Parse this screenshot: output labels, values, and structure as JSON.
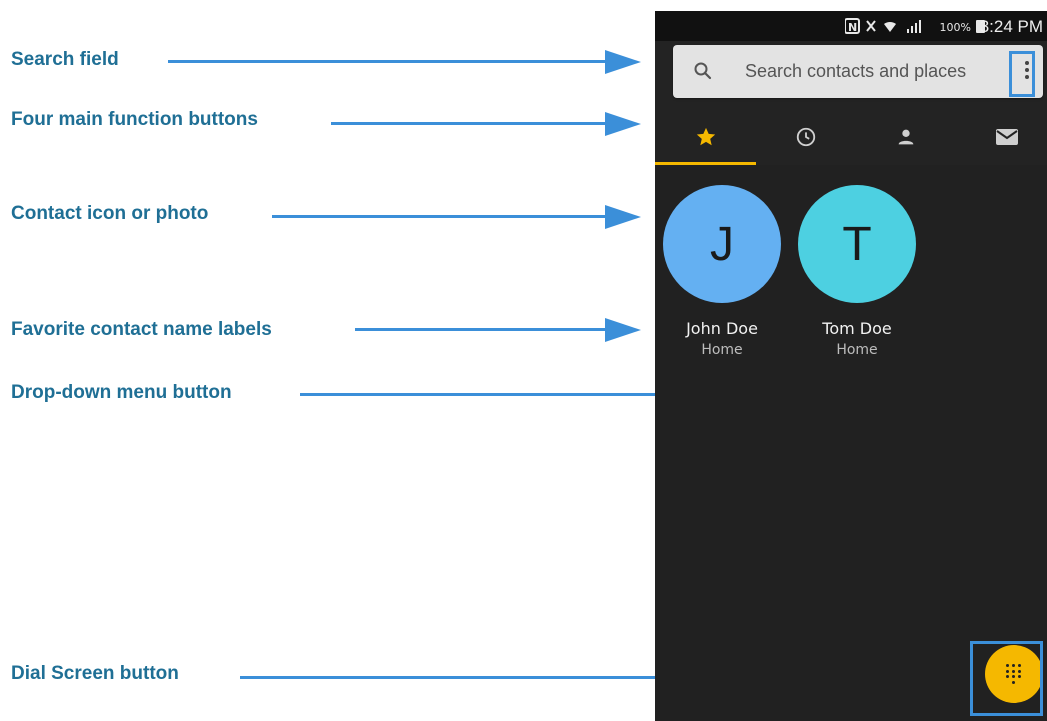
{
  "callouts": {
    "search_field": "Search field",
    "function_buttons": "Four main function buttons",
    "contact_icon": "Contact icon or photo",
    "name_labels": "Favorite contact name labels",
    "dropdown_menu": "Drop-down menu button",
    "dial_screen": "Dial Screen button"
  },
  "status_bar": {
    "battery_percent": "100%",
    "time": "3:24 PM"
  },
  "search": {
    "placeholder": "Search contacts and places"
  },
  "tabs": [
    {
      "icon": "star-icon",
      "selected": true
    },
    {
      "icon": "clock-icon",
      "selected": false
    },
    {
      "icon": "person-icon",
      "selected": false
    },
    {
      "icon": "mail-icon",
      "selected": false
    }
  ],
  "favorites": [
    {
      "initial": "J",
      "name": "John Doe",
      "label": "Home",
      "color": "#64b0f2"
    },
    {
      "initial": "T",
      "name": "Tom Doe",
      "label": "Home",
      "color": "#4dd0e1"
    }
  ],
  "colors": {
    "accent": "#f5b800",
    "callout_text": "#1f6f95",
    "callout_line": "#3b8fd9",
    "app_background": "#212121"
  },
  "fab": {
    "icon": "dialpad-icon"
  }
}
